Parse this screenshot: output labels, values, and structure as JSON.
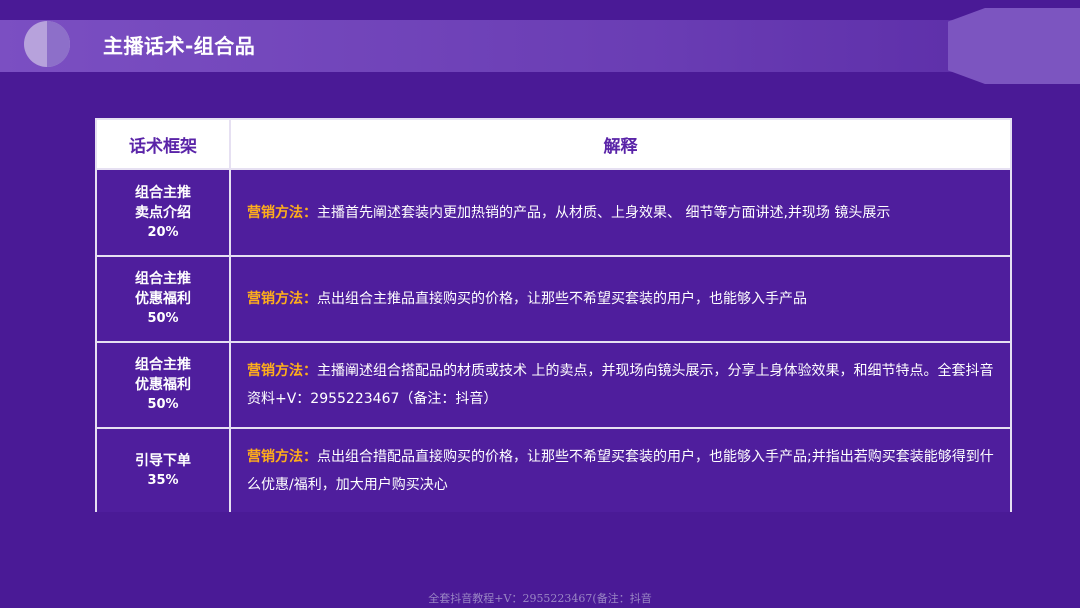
{
  "header": {
    "title": "主播话术-组合品"
  },
  "table": {
    "columns": [
      "话术框架",
      "解释"
    ],
    "method_label": "营销方法：",
    "rows": [
      {
        "category": [
          "组合主推",
          "卖点介绍"
        ],
        "percent": "20%",
        "text": "主播首先阐述套装内更加热销的产品，从材质、上身效果、 细节等方面讲述,并现场 镜头展示"
      },
      {
        "category": [
          "组合主推",
          "优惠福利"
        ],
        "percent": "50%",
        "text": "点出组合主推品直接购买的价格，让那些不希望买套装的用户，也能够入手产品"
      },
      {
        "category": [
          "组合主推",
          "优惠福利"
        ],
        "percent": "50%",
        "text": "主播阐述组合搭配品的材质或技术 上的卖点，并现场向镜头展示，分享上身体验效果，和细节特点。全套抖音资料+V：2955223467（备注：抖音）"
      },
      {
        "category": [
          "引导下单"
        ],
        "percent": "35%",
        "text": "点出组合措配品直接购买的价格，让那些不希望买套装的用户，也能够入手产品;并指出若购买套装能够得到什么优惠/福利，加大用户购买决心"
      }
    ]
  },
  "footer": {
    "watermark": "全套抖音教程+V：2955223467(备注：抖音"
  },
  "colors": {
    "background": "#4a1a96",
    "method_accent": "#ffae1a",
    "header_text": "#5a24a8"
  }
}
